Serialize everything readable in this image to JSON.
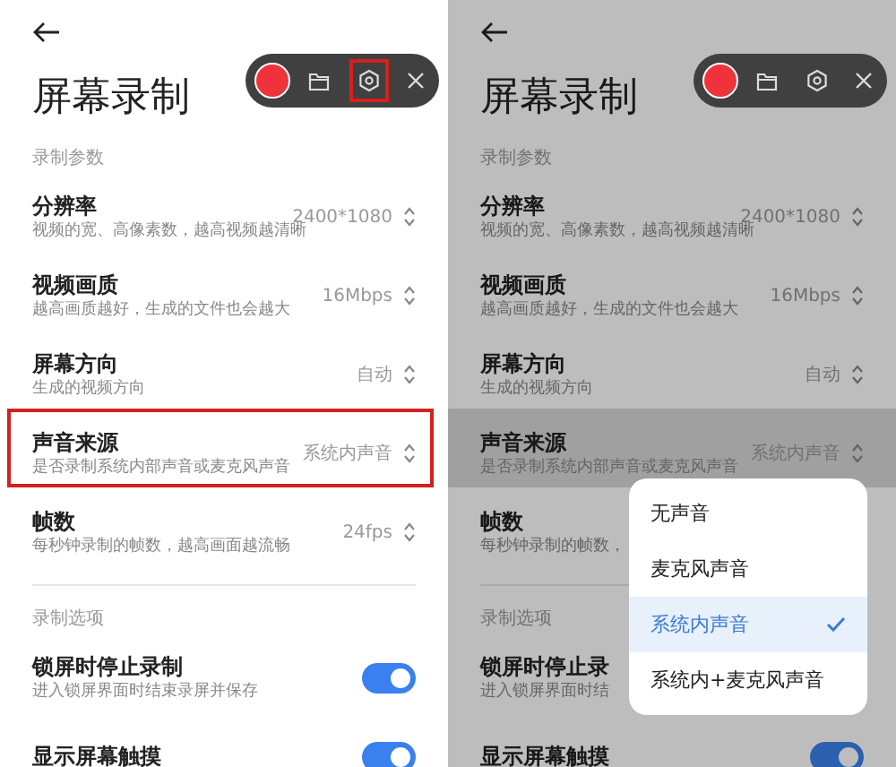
{
  "screens": [
    {
      "dimmed": false,
      "toolbar": {
        "settings_outlined": true
      },
      "title": "屏幕录制",
      "sections": [
        {
          "header": "录制参数",
          "items": [
            {
              "kind": "select",
              "title": "分辨率",
              "subtitle": "视频的宽、高像素数，越高视频越清晰",
              "value": "2400*1080",
              "outlined": false,
              "pressed": false
            },
            {
              "kind": "select",
              "title": "视频画质",
              "subtitle": "越高画质越好，生成的文件也会越大",
              "value": "16Mbps",
              "outlined": false,
              "pressed": false
            },
            {
              "kind": "select",
              "title": "屏幕方向",
              "subtitle": "生成的视频方向",
              "value": "自动",
              "outlined": false,
              "pressed": false
            },
            {
              "kind": "select",
              "title": "声音来源",
              "subtitle": "是否录制系统内部声音或麦克风声音",
              "value": "系统内声音",
              "outlined": true,
              "pressed": false
            },
            {
              "kind": "select",
              "title": "帧数",
              "subtitle": "每秒钟录制的帧数，越高画面越流畅",
              "value": "24fps",
              "outlined": false,
              "pressed": false
            }
          ]
        },
        {
          "header": "录制选项",
          "items": [
            {
              "kind": "toggle",
              "title": "锁屏时停止录制",
              "subtitle": "进入锁屏界面时结束录屏并保存",
              "on": true
            },
            {
              "kind": "toggle",
              "title": "显示屏幕触摸",
              "on": true
            }
          ]
        }
      ]
    },
    {
      "dimmed": true,
      "toolbar": {
        "settings_outlined": false
      },
      "title": "屏幕录制",
      "sections": [
        {
          "header": "录制参数",
          "items": [
            {
              "kind": "select",
              "title": "分辨率",
              "subtitle": "视频的宽、高像素数，越高视频越清晰",
              "value": "2400*1080",
              "outlined": false,
              "pressed": false
            },
            {
              "kind": "select",
              "title": "视频画质",
              "subtitle": "越高画质越好，生成的文件也会越大",
              "value": "16Mbps",
              "outlined": false,
              "pressed": false
            },
            {
              "kind": "select",
              "title": "屏幕方向",
              "subtitle": "生成的视频方向",
              "value": "自动",
              "outlined": false,
              "pressed": false
            },
            {
              "kind": "select",
              "title": "声音来源",
              "subtitle": "是否录制系统内部声音或麦克风声音",
              "value": "系统内声音",
              "outlined": false,
              "pressed": true
            },
            {
              "kind": "select",
              "title": "帧数",
              "subtitle": "每秒钟录制的帧数，",
              "outlined": false,
              "pressed": false
            }
          ]
        },
        {
          "header": "录制选项",
          "items": [
            {
              "kind": "toggle",
              "title": "锁屏时停止录",
              "subtitle": "进入锁屏界面时结"
            },
            {
              "kind": "toggle",
              "title": "显示屏幕触摸",
              "on": true
            }
          ]
        }
      ],
      "popup": {
        "options": [
          {
            "label": "无声音",
            "selected": false
          },
          {
            "label": "麦克风声音",
            "selected": false
          },
          {
            "label": "系统内声音",
            "selected": true
          },
          {
            "label": "系统内+麦克风声音",
            "selected": false
          }
        ]
      }
    }
  ]
}
